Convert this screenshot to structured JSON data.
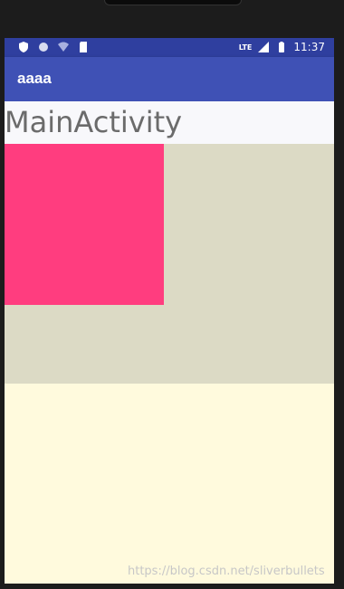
{
  "status_bar": {
    "time": "11:37",
    "network": "LTE"
  },
  "app_bar": {
    "title": "aaaa"
  },
  "content": {
    "heading": "MainActivity",
    "colors": {
      "status_bar": "#2f3f9f",
      "app_bar": "#3f51b5",
      "header_area": "#f8f8fb",
      "beige_panel": "#dcdac5",
      "pink_box": "#ff3d7f",
      "cream_background": "#fffadd"
    }
  },
  "watermark": "https://blog.csdn.net/sliverbullets"
}
